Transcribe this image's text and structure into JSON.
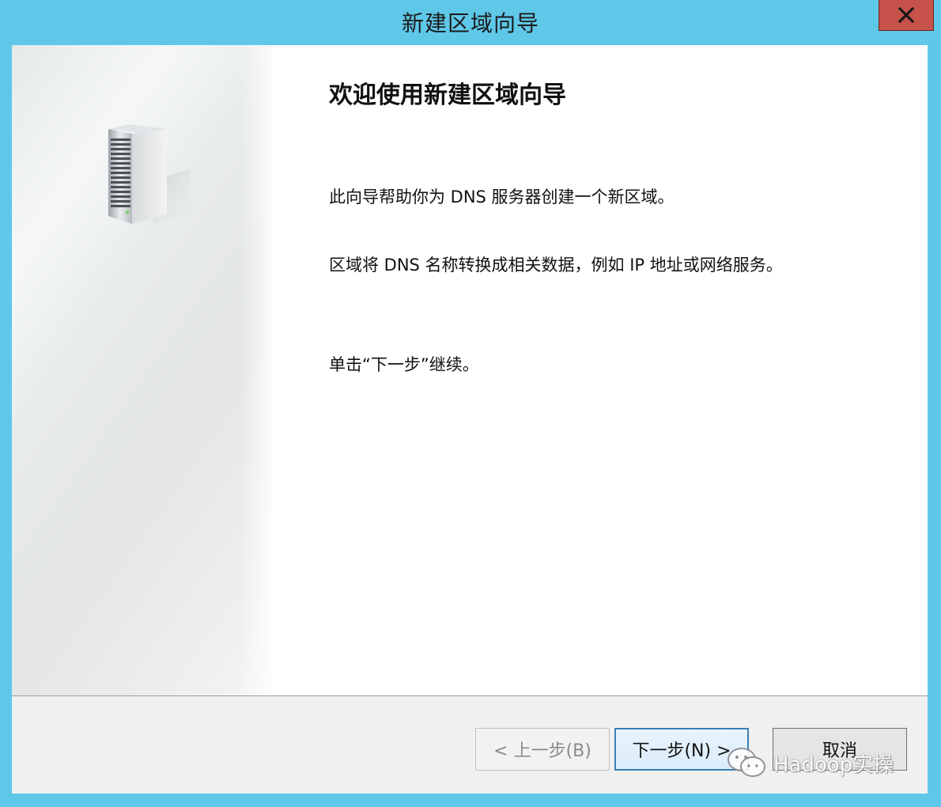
{
  "window": {
    "title": "新建区域向导",
    "close_label": "X",
    "accent_color": "#5fc8e9",
    "close_color": "#c7524b"
  },
  "side_panel": {
    "icon": "server-icon"
  },
  "content": {
    "heading": "欢迎使用新建区域向导",
    "paragraph_1": "此向导帮助你为 DNS 服务器创建一个新区域。",
    "paragraph_2": "区域将 DNS 名称转换成相关数据，例如 IP 地址或网络服务。",
    "paragraph_3": "单击“下一步”继续。"
  },
  "footer": {
    "back_label": "< 上一步(B)",
    "next_label": "下一步(N) >",
    "cancel_label": "取消"
  },
  "watermark": {
    "icon": "wechat-icon",
    "text": "Hadoop实操"
  }
}
